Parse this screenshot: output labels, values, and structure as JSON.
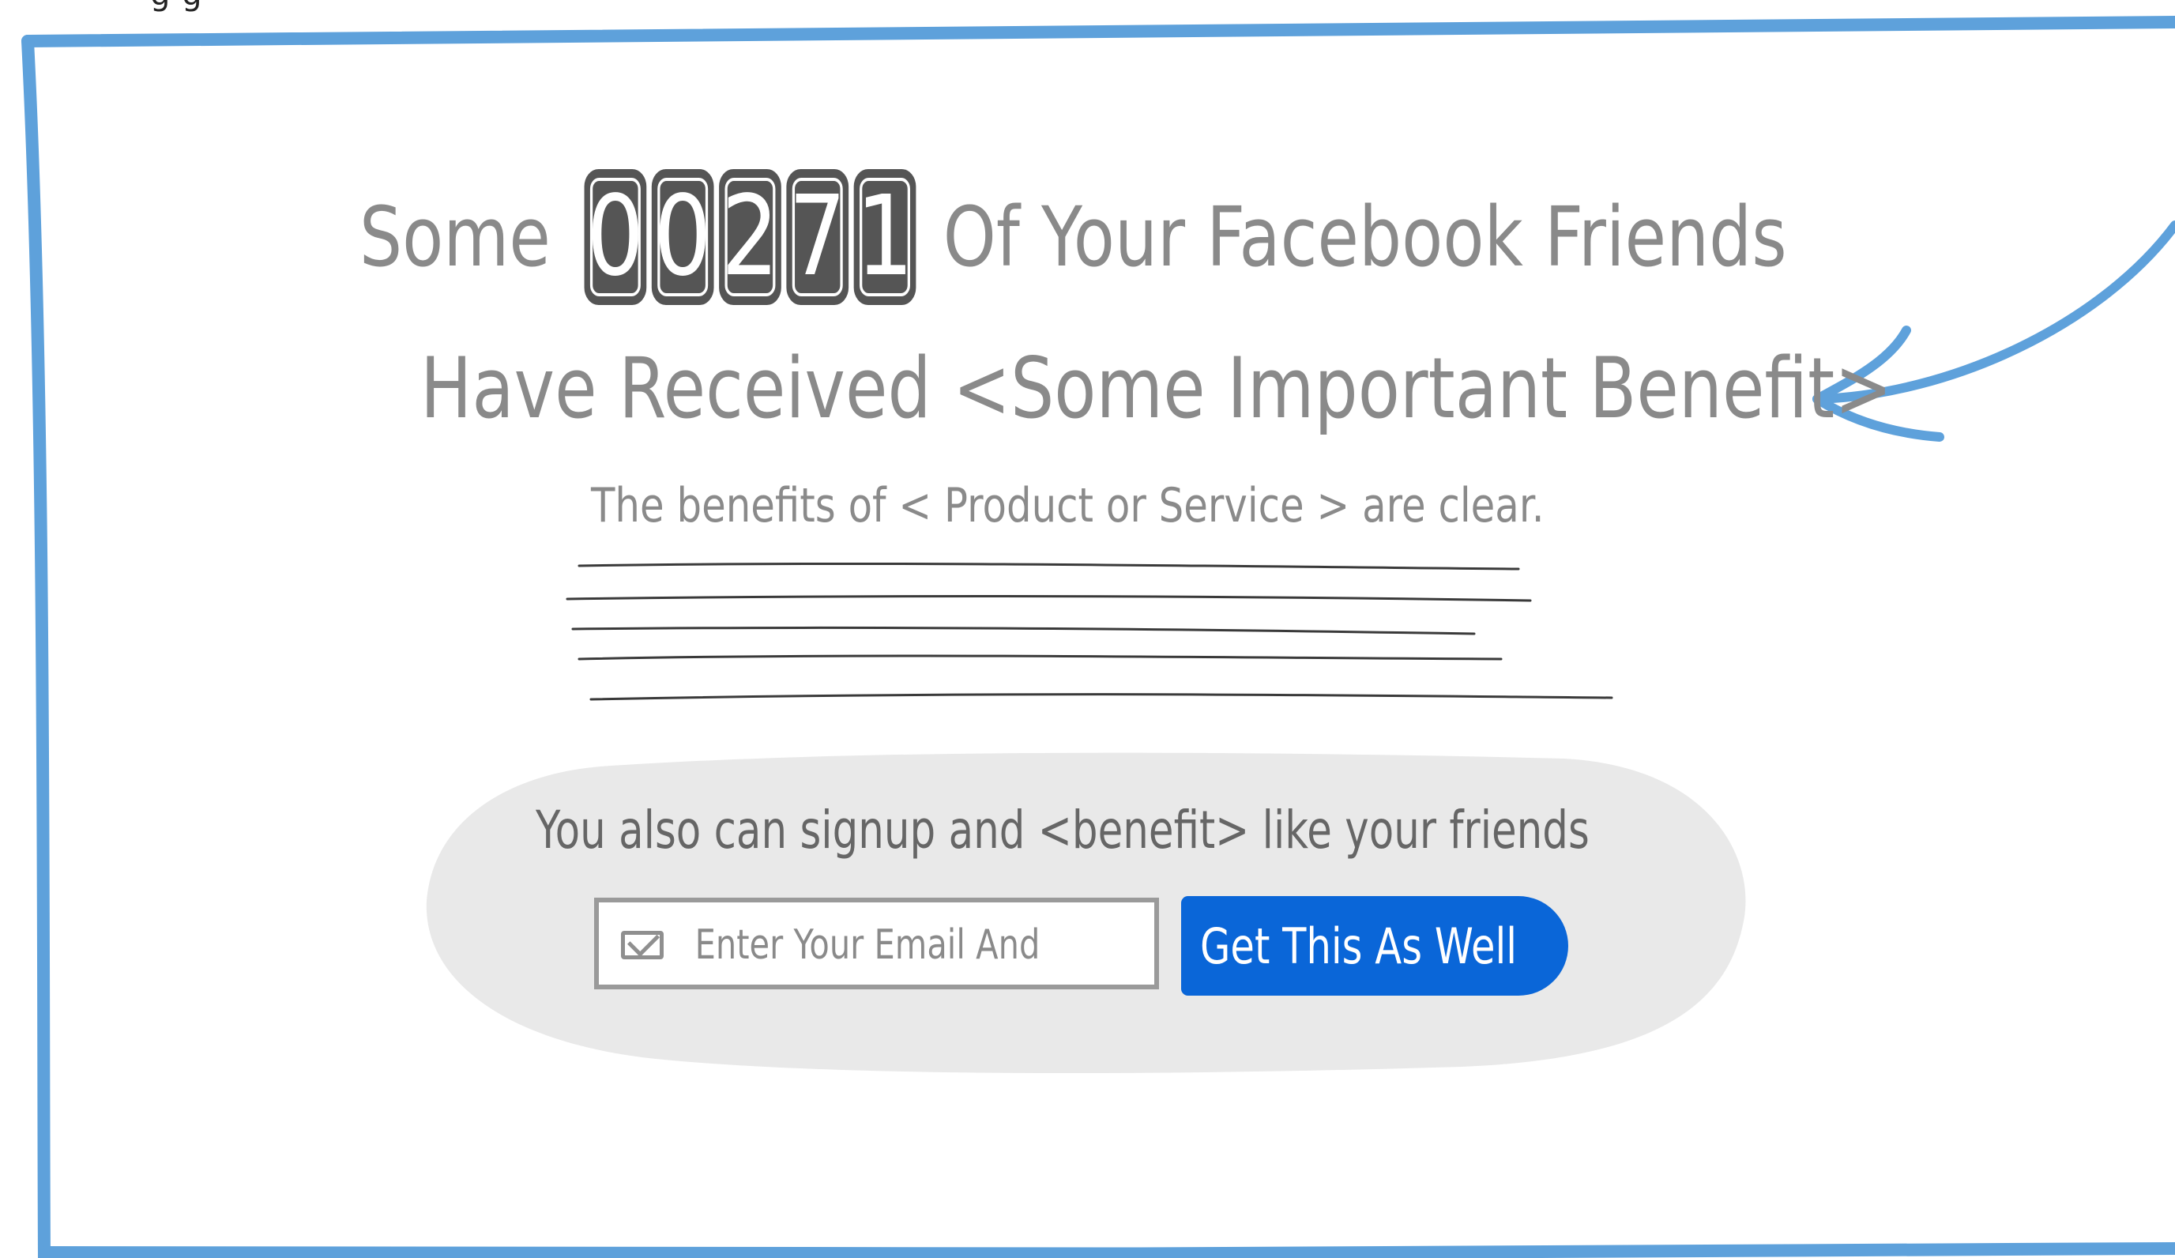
{
  "top_caption": "g   g",
  "headline": {
    "prefix": "Some",
    "counter_digits": [
      "0",
      "0",
      "2",
      "7",
      "1"
    ],
    "suffix": "Of Your Facebook Friends",
    "line2": "Have Received <Some Important Benefit>"
  },
  "subheadline": "The benefits of < Product or Service > are clear.",
  "cta": {
    "text": "You also can signup and <benefit> like your friends",
    "email_placeholder": "Enter Your Email And",
    "button_label": "Get This As Well"
  },
  "colors": {
    "frame": "#5ea1db",
    "headline_text": "#8a8a8a",
    "counter_bg": "#555555",
    "panel_bg": "#e9e9e9",
    "button_bg": "#0a66d8",
    "button_text": "#ffffff"
  },
  "icons": {
    "email": "envelope-icon",
    "arrow": "hand-drawn-arrow"
  }
}
